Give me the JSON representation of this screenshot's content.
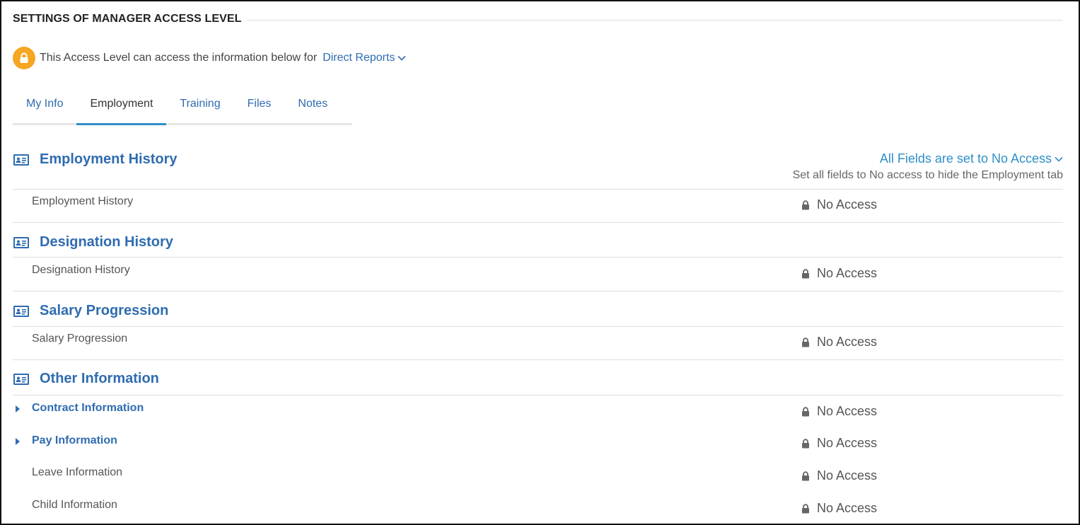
{
  "header": {
    "title": "SETTINGS OF MANAGER ACCESS LEVEL"
  },
  "access_scope": {
    "text": "This Access Level can access the information below for",
    "scope_label": "Direct Reports",
    "badge_icon": "lock-icon",
    "badge_color": "#f5a623"
  },
  "tabs": [
    {
      "label": "My Info"
    },
    {
      "label": "Employment",
      "active": true
    },
    {
      "label": "Training"
    },
    {
      "label": "Files"
    },
    {
      "label": "Notes"
    }
  ],
  "bulk": {
    "label": "All Fields are set to No Access",
    "hint": "Set all fields to No access to hide the Employment tab"
  },
  "groups": [
    {
      "title": "Employment History",
      "fields": [
        {
          "label": "Employment History",
          "access": "No Access"
        }
      ]
    },
    {
      "title": "Designation History",
      "fields": [
        {
          "label": "Designation History",
          "access": "No Access"
        }
      ]
    },
    {
      "title": "Salary Progression",
      "fields": [
        {
          "label": "Salary Progression",
          "access": "No Access"
        }
      ]
    },
    {
      "title": "Other Information",
      "fields": [
        {
          "label": "Contract Information",
          "access": "No Access",
          "expandable": true
        },
        {
          "label": "Pay Information",
          "access": "No Access",
          "expandable": true
        },
        {
          "label": "Leave Information",
          "access": "No Access"
        },
        {
          "label": "Child Information",
          "access": "No Access"
        }
      ]
    }
  ],
  "colors": {
    "link": "#2f6cb0",
    "tab_underline": "#2f8fc8",
    "lock_badge": "#f5a623"
  }
}
